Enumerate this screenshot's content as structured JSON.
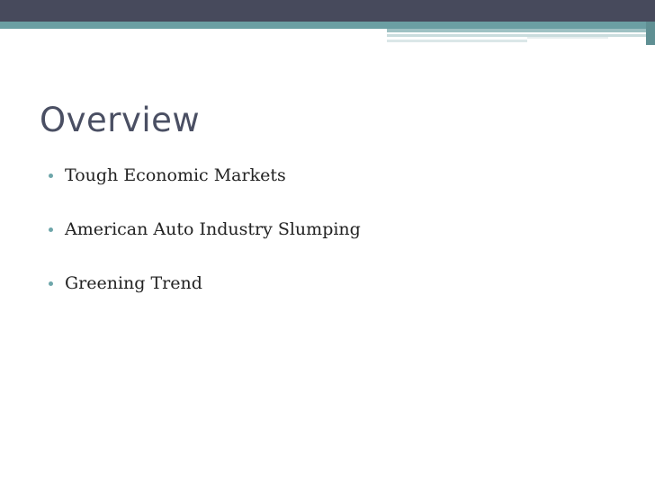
{
  "slide": {
    "title": "Overview",
    "bullets": [
      {
        "text": "Tough Economic Markets"
      },
      {
        "text": "American Auto Industry Slumping"
      },
      {
        "text": "Greening Trend"
      }
    ]
  },
  "colors": {
    "header_dark": "#474a5c",
    "header_teal": "#6b9fa3",
    "title_text": "#4a4f63",
    "bullet_marker": "#6ea6aa",
    "body_text": "#222222"
  }
}
